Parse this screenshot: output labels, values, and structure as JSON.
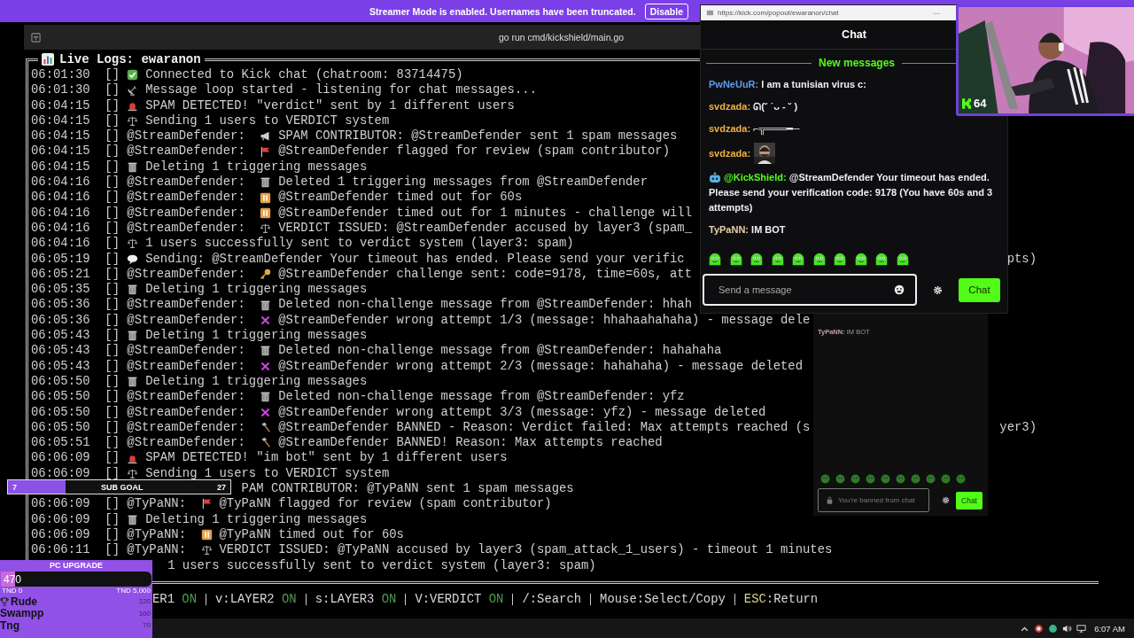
{
  "banner": {
    "text": "Streamer Mode is enabled. Usernames have been truncated.",
    "button": "Disable"
  },
  "terminal": {
    "title": "go run cmd/kickshield/main.go",
    "log_title": "Live Logs: ewaranon",
    "lines": [
      {
        "time": "06:01:30",
        "tag": "[]",
        "kind": "check",
        "text": "Connected to Kick chat (chatroom: 83714475)"
      },
      {
        "time": "06:01:30",
        "tag": "[]",
        "kind": "dish",
        "text": "Message loop started - listening for chat messages..."
      },
      {
        "time": "06:04:15",
        "tag": "[]",
        "kind": "siren",
        "text": "SPAM DETECTED! \"verdict\" sent by 1 different users"
      },
      {
        "time": "06:04:15",
        "tag": "[]",
        "kind": "scales",
        "text": "Sending 1 users to VERDICT system"
      },
      {
        "time": "06:04:15",
        "tag": "[]",
        "user": "@StreamDefender:",
        "kind": "megaphone",
        "text": "SPAM CONTRIBUTOR: @StreamDefender sent 1 spam messages"
      },
      {
        "time": "06:04:15",
        "tag": "[]",
        "user": "@StreamDefender:",
        "kind": "flag",
        "text": "@StreamDefender flagged for review (spam contributor)"
      },
      {
        "time": "06:04:15",
        "tag": "[]",
        "kind": "trash",
        "text": "Deleting 1 triggering messages"
      },
      {
        "time": "06:04:16",
        "tag": "[]",
        "user": "@StreamDefender:",
        "kind": "trash",
        "text": "Deleted 1 triggering messages from @StreamDefender"
      },
      {
        "time": "06:04:16",
        "tag": "[]",
        "user": "@StreamDefender:",
        "kind": "pause",
        "text": "@StreamDefender timed out for 60s"
      },
      {
        "time": "06:04:16",
        "tag": "[]",
        "user": "@StreamDefender:",
        "kind": "pause",
        "text": "@StreamDefender timed out for 1 minutes - challenge will"
      },
      {
        "time": "06:04:16",
        "tag": "[]",
        "user": "@StreamDefender:",
        "kind": "scales",
        "text": "VERDICT ISSUED: @StreamDefender accused by layer3 (spam_"
      },
      {
        "time": "06:04:16",
        "tag": "[]",
        "kind": "scales",
        "text": "1 users successfully sent to verdict system (layer3: spam)"
      },
      {
        "time": "06:05:19",
        "tag": "[]",
        "kind": "speech",
        "text": "Sending: @StreamDefender Your timeout has ended. Please send your verific",
        "tail": "pts)"
      },
      {
        "time": "06:05:21",
        "tag": "[]",
        "user": "@StreamDefender:",
        "kind": "key",
        "text": "@StreamDefender challenge sent: code=9178, time=60s, att"
      },
      {
        "time": "06:05:35",
        "tag": "[]",
        "kind": "trash",
        "text": "Deleting 1 triggering messages"
      },
      {
        "time": "06:05:36",
        "tag": "[]",
        "user": "@StreamDefender:",
        "kind": "trash",
        "text": "Deleted non-challenge message from @StreamDefender: hhah"
      },
      {
        "time": "06:05:36",
        "tag": "[]",
        "user": "@StreamDefender:",
        "kind": "cross",
        "text": "@StreamDefender wrong attempt 1/3 (message: hhahaahahaha) - message dele"
      },
      {
        "time": "06:05:43",
        "tag": "[]",
        "kind": "trash",
        "text": "Deleting 1 triggering messages"
      },
      {
        "time": "06:05:43",
        "tag": "[]",
        "user": "@StreamDefender:",
        "kind": "trash",
        "text": "Deleted non-challenge message from @StreamDefender: hahahaha"
      },
      {
        "time": "06:05:43",
        "tag": "[]",
        "user": "@StreamDefender:",
        "kind": "cross",
        "text": "@StreamDefender wrong attempt 2/3 (message: hahahaha) - message deleted"
      },
      {
        "time": "06:05:50",
        "tag": "[]",
        "kind": "trash",
        "text": "Deleting 1 triggering messages"
      },
      {
        "time": "06:05:50",
        "tag": "[]",
        "user": "@StreamDefender:",
        "kind": "trash",
        "text": "Deleted non-challenge message from @StreamDefender: yfz"
      },
      {
        "time": "06:05:50",
        "tag": "[]",
        "user": "@StreamDefender:",
        "kind": "cross",
        "text": "@StreamDefender wrong attempt 3/3 (message: yfz) - message deleted"
      },
      {
        "time": "06:05:50",
        "tag": "[]",
        "user": "@StreamDefender:",
        "kind": "hammer",
        "text": "@StreamDefender BANNED - Reason: Verdict failed: Max attempts reached (s",
        "tail": "yer3)"
      },
      {
        "time": "06:05:51",
        "tag": "[]",
        "user": "@StreamDefender:",
        "kind": "hammer",
        "text": "@StreamDefender BANNED! Reason: Max attempts reached"
      },
      {
        "time": "06:06:09",
        "tag": "[]",
        "kind": "siren",
        "text": "SPAM DETECTED! \"im bot\" sent by 1 different users"
      },
      {
        "time": "06:06:09",
        "tag": "[]",
        "kind": "scales",
        "text": "Sending 1 users to VERDICT system"
      },
      {
        "kind": "hidden_user",
        "text": "PAM CONTRIBUTOR: @TyPaNN sent 1 spam messages"
      },
      {
        "time": "06:06:09",
        "tag": "[]",
        "user": "@TyPaNN:",
        "kind": "flag",
        "text": "@TyPaNN flagged for review (spam contributor)"
      },
      {
        "time": "06:06:09",
        "tag": "[]",
        "kind": "trash",
        "text": "Deleting 1 triggering messages"
      },
      {
        "time": "06:06:09",
        "tag": "[]",
        "user": "@TyPaNN:",
        "kind": "pause",
        "text": "@TyPaNN timed out for 60s"
      },
      {
        "time": "06:06:11",
        "tag": "[]",
        "user": "@TyPaNN:",
        "kind": "scales",
        "text": "VERDICT ISSUED: @TyPaNN accused by layer3 (spam_attack_1_users) - timeout 1 minutes"
      },
      {
        "kind": "hidden_plain",
        "text": "1 users successfully sent to verdict system (layer3: spam)"
      }
    ],
    "status_items": [
      {
        "label": "ER1",
        "state": "ON",
        "on": true
      },
      {
        "key": "v:",
        "label": "LAYER2",
        "state": "ON",
        "on": true
      },
      {
        "key": "s:",
        "label": "LAYER3",
        "state": "ON",
        "on": true
      },
      {
        "key": "V:",
        "label": "VERDICT",
        "state": "ON",
        "on": true
      },
      {
        "key": "/:",
        "label": "Search"
      },
      {
        "key": "Mouse:",
        "label": "Select/Copy"
      },
      {
        "key": "ESC",
        "label": ":Return"
      }
    ]
  },
  "chat_window": {
    "url": "https://kick.com/popout/ewaranon/chat",
    "minimize": "—",
    "title": "Chat",
    "divider": "New messages",
    "messages": [
      {
        "kind": "text",
        "user": "PwNeUuR:",
        "color": "#5b9cf2",
        "text": "I am a tunisian virus c:"
      },
      {
        "kind": "text",
        "user": "svdzada:",
        "color": "#f0b23e",
        "text": "ᘏ(˘ ˙ᴗ - ˘ )"
      },
      {
        "kind": "text",
        "user": "svdzada:",
        "color": "#f0b23e",
        "text": "⌐╦═══━─"
      },
      {
        "user": "svdzada:",
        "color": "#f0b23e"
      },
      {
        "kind": "bot",
        "user": "@KickShield:",
        "color": "#53fc18",
        "text": "@StreamDefender Your timeout has ended. Please send your verification code: 9178 (You have 60s and 3 attempts)"
      },
      {
        "kind": "text",
        "user": "TyPaNN:",
        "color": "#e9cfae",
        "text": "IM BOT"
      }
    ],
    "input": {
      "placeholder": "Send a message"
    },
    "send_button": "Chat"
  },
  "background_chat": {
    "messages": [
      {
        "user": "TyPaNN:",
        "text": "IM BOT"
      }
    ],
    "banned_notice": "You're banned from chat",
    "send_button": "Chat"
  },
  "webcam": {
    "viewer_count": "64"
  },
  "sub_goal": {
    "current": "7",
    "label": "SUB GOAL",
    "target": "27",
    "level": 0.26
  },
  "pc_upgrade": {
    "title": "PC UPGRADE",
    "amount": "470",
    "level": 0.094,
    "min": "TND 0",
    "max": "TND 5,000",
    "leaders": [
      {
        "name": "Rude",
        "score": "120",
        "top": true
      },
      {
        "name": "Swampp",
        "score": "100",
        "top": false
      },
      {
        "name": "Tng",
        "score": "70",
        "top": false
      }
    ]
  },
  "taskbar": {
    "clock": "6:07 AM"
  }
}
